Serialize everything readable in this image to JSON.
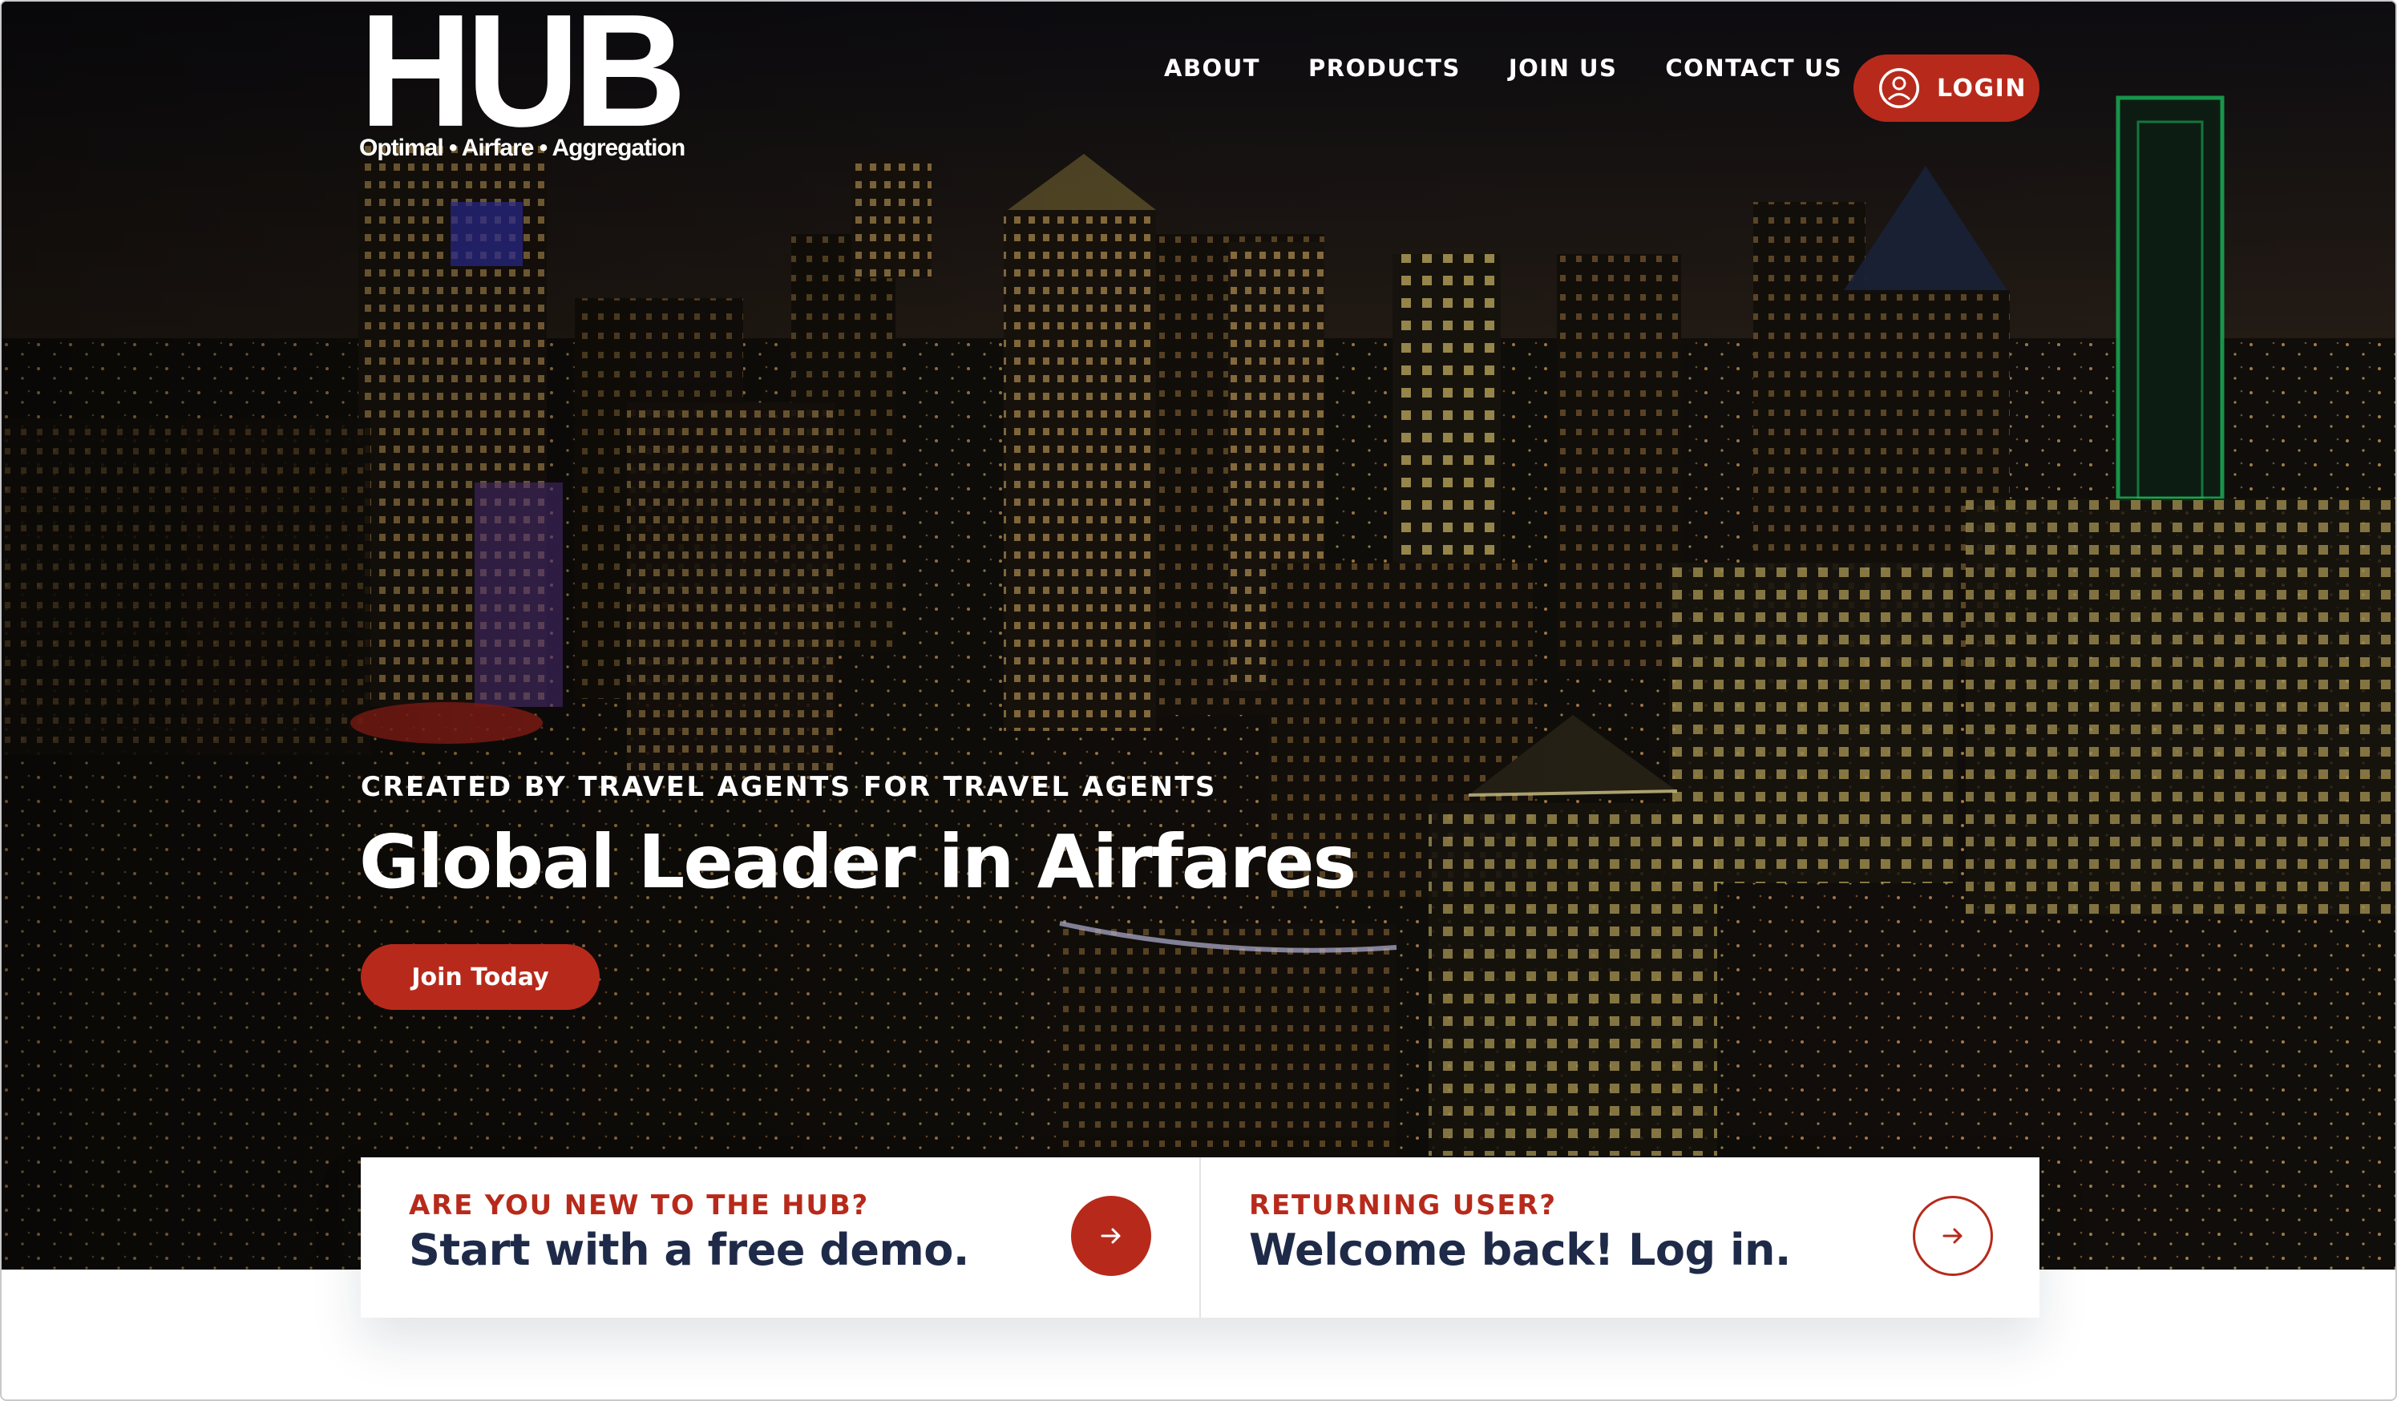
{
  "logo": {
    "wordmark": "HUB",
    "tagline": "Optimal • Airfare • Aggregation"
  },
  "nav": {
    "items": [
      {
        "label": "ABOUT"
      },
      {
        "label": "PRODUCTS"
      },
      {
        "label": "JOIN US"
      },
      {
        "label": "CONTACT US"
      }
    ],
    "login": {
      "label": "LOGIN",
      "icon": "user-circle-icon"
    }
  },
  "hero": {
    "eyebrow": "CREATED BY TRAVEL AGENTS FOR TRAVEL AGENTS",
    "headline": "Global Leader in Airfares",
    "cta_label": "Join Today",
    "background": "night city skyline photo"
  },
  "cards": [
    {
      "eyebrow": "ARE YOU NEW TO THE HUB?",
      "title": "Start with a free demo.",
      "icon": "arrow-right-icon",
      "style": "filled"
    },
    {
      "eyebrow": "RETURNING USER?",
      "title": "Welcome back! Log in.",
      "icon": "arrow-right-icon",
      "style": "outline"
    }
  ],
  "colors": {
    "accent": "#b72a1b",
    "heading_navy": "#1e2a48",
    "text_light": "#ffffff"
  }
}
